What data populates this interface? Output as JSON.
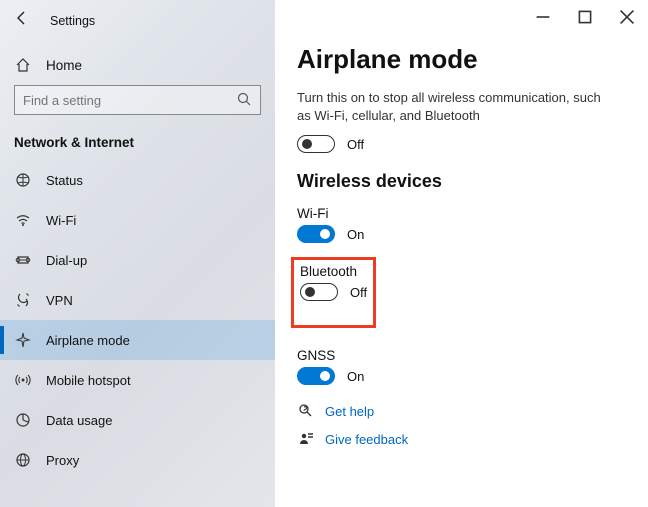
{
  "window": {
    "title": "Settings"
  },
  "header": {
    "home": "Home"
  },
  "search": {
    "placeholder": "Find a setting"
  },
  "category": "Network & Internet",
  "nav": [
    {
      "icon": "status",
      "label": "Status"
    },
    {
      "icon": "wifi",
      "label": "Wi-Fi"
    },
    {
      "icon": "dialup",
      "label": "Dial-up"
    },
    {
      "icon": "vpn",
      "label": "VPN"
    },
    {
      "icon": "airplane",
      "label": "Airplane mode",
      "selected": true
    },
    {
      "icon": "hotspot",
      "label": "Mobile hotspot"
    },
    {
      "icon": "data",
      "label": "Data usage"
    },
    {
      "icon": "proxy",
      "label": "Proxy"
    }
  ],
  "main": {
    "title": "Airplane mode",
    "description": "Turn this on to stop all wireless communication, such as Wi-Fi, cellular, and Bluetooth",
    "airplane_toggle": {
      "state": "Off",
      "on": false
    },
    "section_title": "Wireless devices",
    "devices": [
      {
        "name": "Wi-Fi",
        "state": "On",
        "on": true,
        "highlight": false
      },
      {
        "name": "Bluetooth",
        "state": "Off",
        "on": false,
        "highlight": true
      },
      {
        "name": "GNSS",
        "state": "On",
        "on": true,
        "highlight": false
      }
    ],
    "links": {
      "help": "Get help",
      "feedback": "Give feedback"
    }
  }
}
